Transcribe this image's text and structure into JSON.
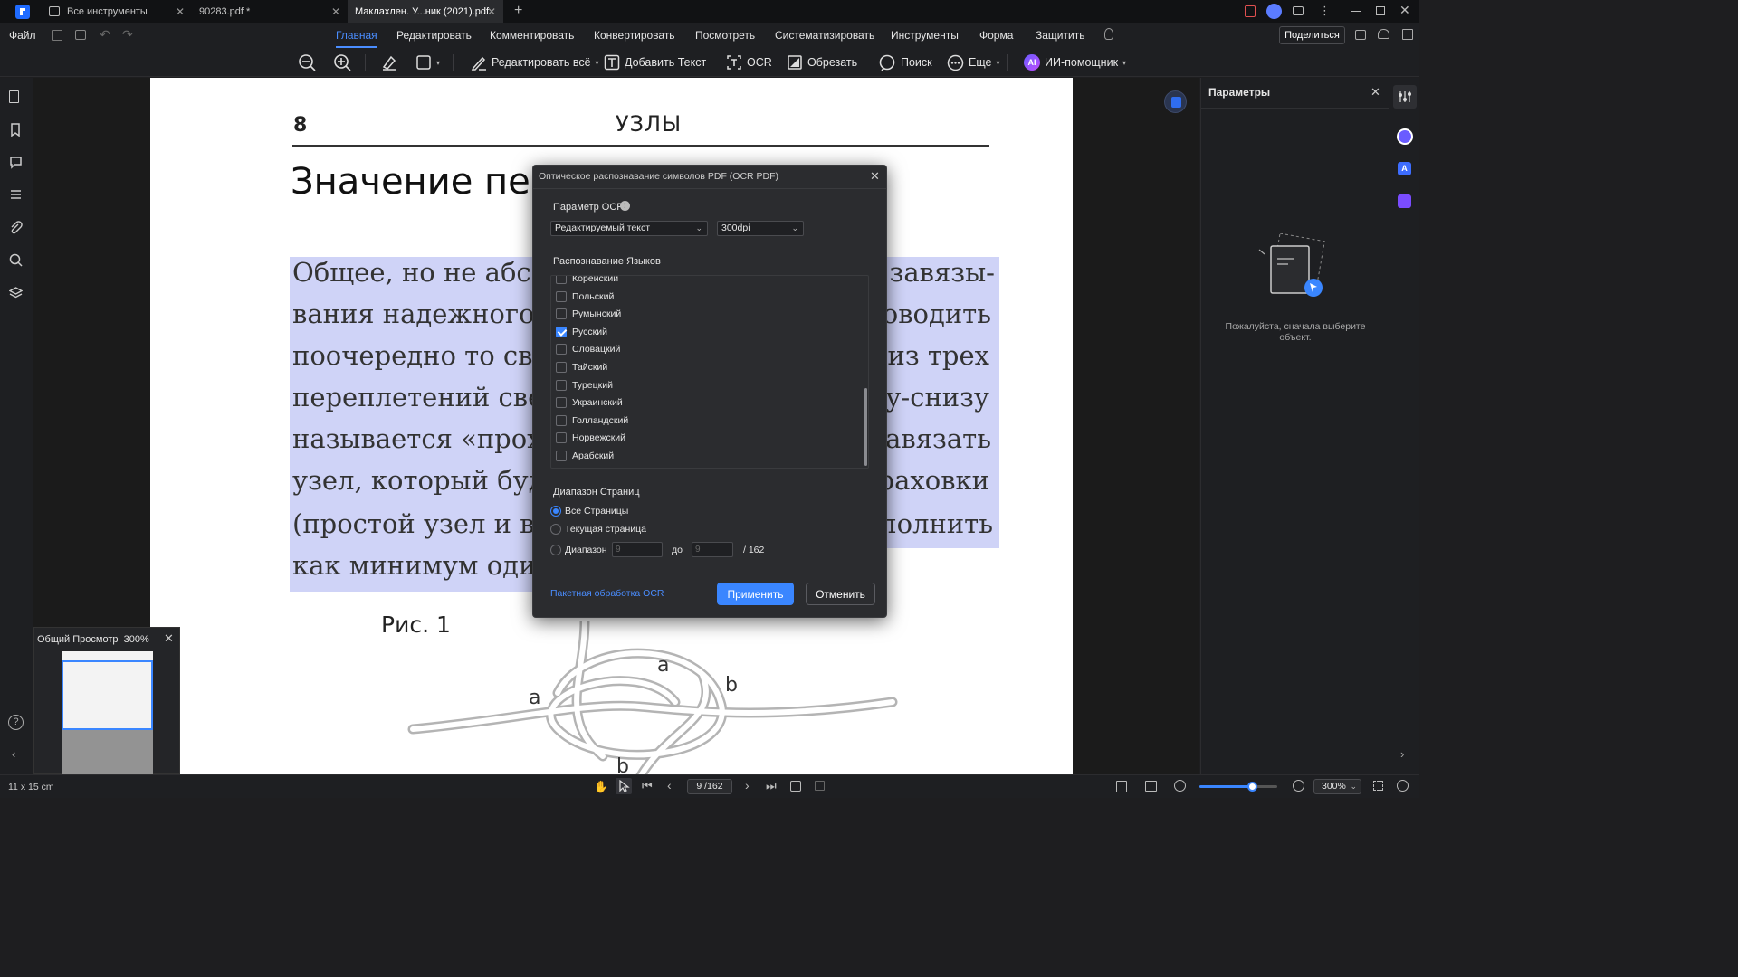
{
  "tabs": [
    {
      "label": "Все инструменты"
    },
    {
      "label": "90283.pdf *"
    },
    {
      "label": "Маклахлен. У...ник (2021).pdf"
    }
  ],
  "menu": {
    "file": "Файл",
    "items": [
      "Главная",
      "Редактировать",
      "Комментировать",
      "Конвертировать",
      "Посмотреть",
      "Систематизировать",
      "Инструменты",
      "Форма",
      "Защитить"
    ],
    "active": "Главная",
    "share": "Поделиться"
  },
  "toolbar": {
    "edit_all": "Редактировать всё",
    "add_text": "Добавить Текст",
    "ocr": "OCR",
    "crop": "Обрезать",
    "search": "Поиск",
    "more": "Еще",
    "ai": "ИИ-помощник",
    "ai_badge": "AI"
  },
  "document": {
    "page_number": "8",
    "running_head": "УЗЛЫ",
    "heading": "Значение пер",
    "lines": [
      "Общее, но не абсолю",
      "вания надежного уз",
      "поочередно то свер",
      "переплетений сверху",
      "называется «проход",
      "узел, который будет д",
      "(простой узел и выбл",
      "как минимум один п"
    ],
    "lines_right": [
      "я завязы-",
      "проводить",
      "и из трех",
      "ху-снизу",
      "завязать",
      "траховки",
      "полнить",
      ""
    ],
    "figure_label": "Рис. 1",
    "figure_marks": [
      "a",
      "a",
      "b",
      "b"
    ]
  },
  "dialog": {
    "title": "Оптическое распознавание символов PDF (OCR PDF)",
    "ocr_param_label": "Параметр OCR",
    "mode_value": "Редактируемый текст",
    "dpi_value": "300dpi",
    "lang_label": "Распознавание Языков",
    "languages": [
      {
        "name": "Корейский",
        "checked": false
      },
      {
        "name": "Польский",
        "checked": false
      },
      {
        "name": "Румынский",
        "checked": false
      },
      {
        "name": "Русский",
        "checked": true
      },
      {
        "name": "Словацкий",
        "checked": false
      },
      {
        "name": "Тайский",
        "checked": false
      },
      {
        "name": "Турецкий",
        "checked": false
      },
      {
        "name": "Украинский",
        "checked": false
      },
      {
        "name": "Голландский",
        "checked": false
      },
      {
        "name": "Норвежский",
        "checked": false
      },
      {
        "name": "Арабский",
        "checked": false
      }
    ],
    "range_label": "Диапазон Страниц",
    "all_pages": "Все Страницы",
    "current_page": "Текущая страница",
    "range": "Диапазон",
    "range_from_placeholder": "9",
    "range_to_word": "до",
    "range_to_placeholder": "9",
    "total_pages": "/ 162",
    "batch_link": "Пакетная обработка OCR",
    "apply": "Применить",
    "cancel": "Отменить"
  },
  "right_panel": {
    "title": "Параметры",
    "hint": "Пожалуйста, сначала выберите объект."
  },
  "overview": {
    "title": "Общий Просмотр",
    "zoom": "300%"
  },
  "status": {
    "page_size": "11 x 15 cm",
    "page_indicator": "9 /162",
    "zoom": "300%",
    "zoom_fraction": 0.67
  },
  "colors": {
    "accent": "#3a86ff",
    "highlight": "#cfd3f7"
  }
}
